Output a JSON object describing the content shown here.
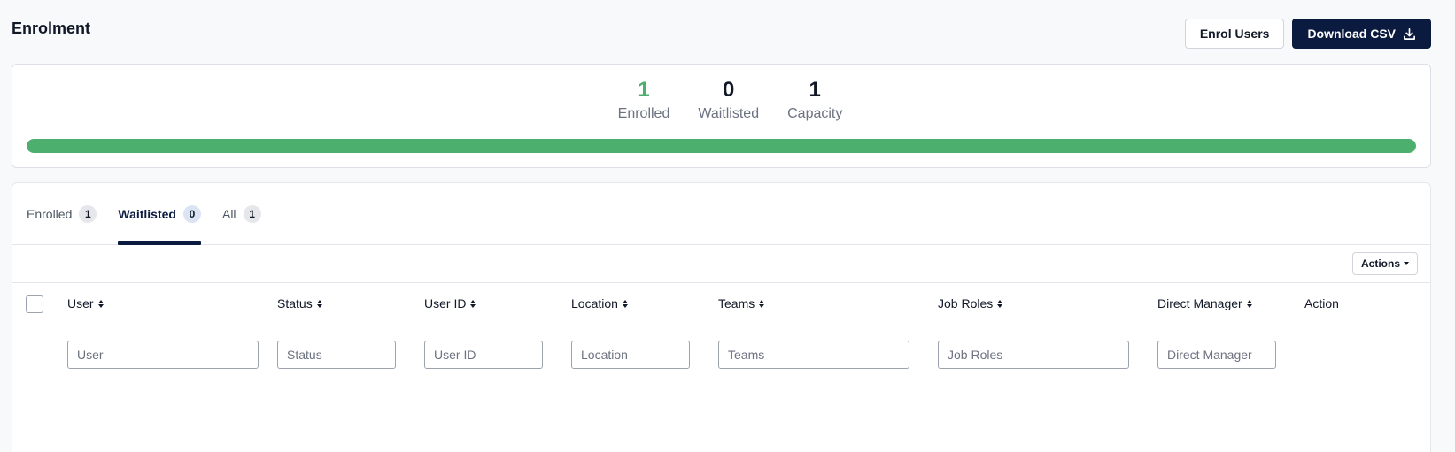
{
  "header": {
    "title": "Enrolment",
    "enrol_users_label": "Enrol Users",
    "download_csv_label": "Download CSV"
  },
  "stats": {
    "enrolled": {
      "value": "1",
      "label": "Enrolled"
    },
    "waitlisted": {
      "value": "0",
      "label": "Waitlisted"
    },
    "capacity": {
      "value": "1",
      "label": "Capacity"
    },
    "progress_percent": 100
  },
  "tabs": [
    {
      "label": "Enrolled",
      "count": "1"
    },
    {
      "label": "Waitlisted",
      "count": "0",
      "active": true
    },
    {
      "label": "All",
      "count": "1"
    }
  ],
  "toolbar": {
    "actions_label": "Actions"
  },
  "table": {
    "columns": [
      {
        "label": "User",
        "placeholder": "User"
      },
      {
        "label": "Status",
        "placeholder": "Status"
      },
      {
        "label": "User ID",
        "placeholder": "User ID"
      },
      {
        "label": "Location",
        "placeholder": "Location"
      },
      {
        "label": "Teams",
        "placeholder": "Teams"
      },
      {
        "label": "Job Roles",
        "placeholder": "Job Roles"
      },
      {
        "label": "Direct Manager",
        "placeholder": "Direct Manager"
      },
      {
        "label": "Action"
      }
    ]
  },
  "colors": {
    "primary": "#0b1a3f",
    "success": "#4caf6e"
  }
}
